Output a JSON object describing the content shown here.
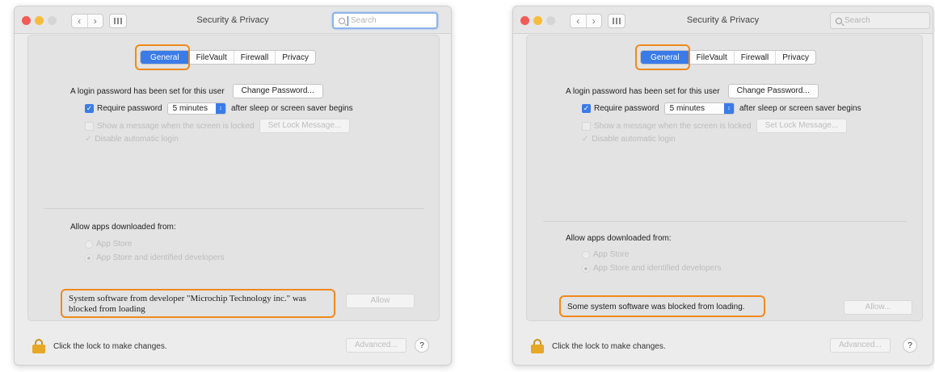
{
  "window": {
    "title": "Security & Privacy",
    "search_placeholder": "Search"
  },
  "tabs": [
    "General",
    "FileVault",
    "Firewall",
    "Privacy"
  ],
  "active_tab": "General",
  "general": {
    "login_text": "A login password has been set for this user",
    "change_password_button": "Change Password...",
    "require_password_label": "Require password",
    "require_password_value": "5 minutes",
    "require_password_suffix": "after sleep or screen saver begins",
    "show_message_label": "Show a message when the screen is locked",
    "set_lock_message_button": "Set Lock Message...",
    "disable_login_label": "Disable automatic login"
  },
  "allow_apps": {
    "heading": "Allow apps downloaded from:",
    "options": [
      "App Store",
      "App Store and identified developers"
    ],
    "selected": "App Store and identified developers"
  },
  "left_panel": {
    "blocked_message_line1": "System software from developer \"Microchip Technology inc.\" was",
    "blocked_message_line2": "blocked from loading",
    "allow_button": "Allow"
  },
  "right_panel": {
    "blocked_message": "Some system software was blocked from loading.",
    "allow_button": "Allow..."
  },
  "footer": {
    "lock_text": "Click the lock to make changes.",
    "advanced_button": "Advanced...",
    "help_button": "?"
  },
  "colors": {
    "highlight": "#f08a1c",
    "accent": "#3a7be8",
    "lock": "#e7a826"
  }
}
